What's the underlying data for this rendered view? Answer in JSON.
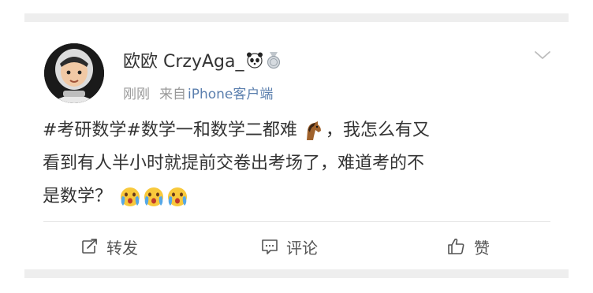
{
  "post": {
    "author": {
      "name": "欧欧 CrzyAga_"
    },
    "meta": {
      "time": "刚刚",
      "source_prefix": "来自",
      "source": "iPhone客户端"
    },
    "content": {
      "line1_text": "#考研数学#数学一和数学二都难",
      "line1_suffix": "，我怎么有又",
      "line2": "看到有人半小时就提前交卷出考场了，难道考的不",
      "line3_text": "是数学？"
    },
    "icons": {
      "badge1": "panda-icon",
      "badge2": "medal-icon",
      "inline_emoji": "horse-emoji-icon",
      "trailing_emoji": "crying-face-emoji-icon",
      "menu": "chevron-down-icon"
    },
    "actions": {
      "repost": "转发",
      "comment": "评论",
      "like": "赞"
    }
  }
}
